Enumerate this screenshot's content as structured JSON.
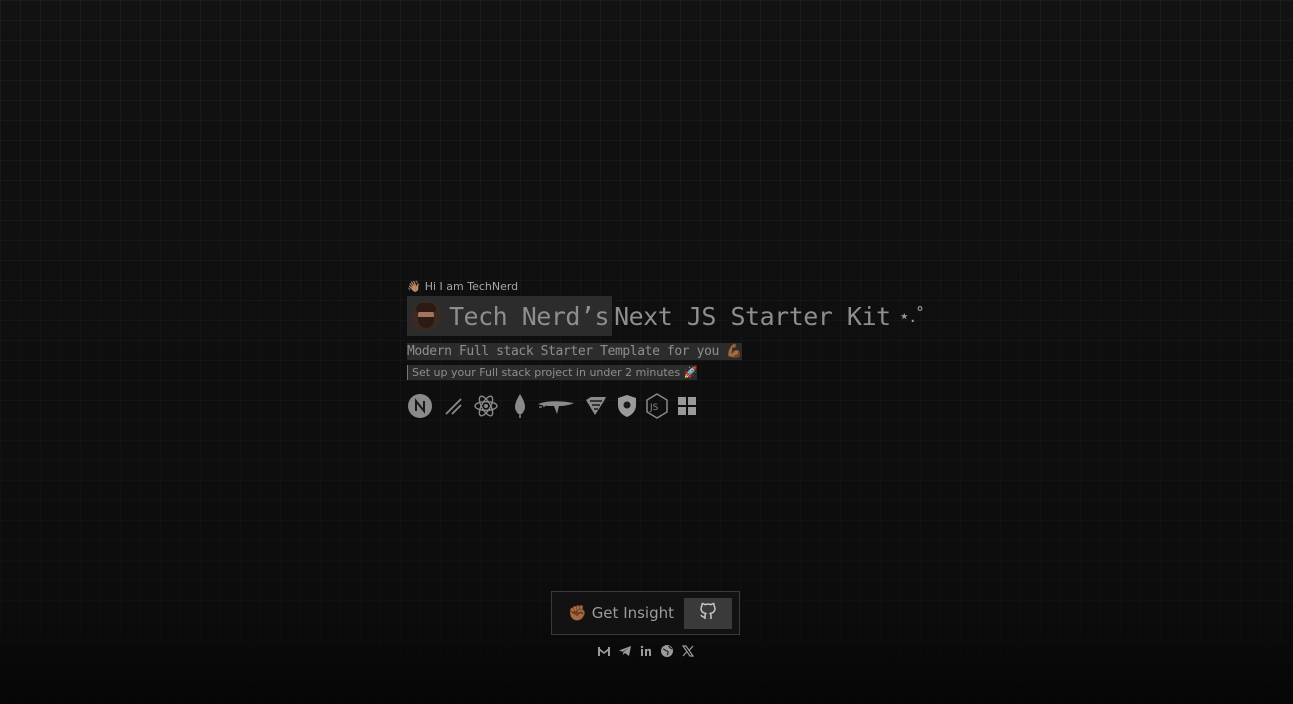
{
  "hero": {
    "greeting_emoji": "👋🏽",
    "greeting": "Hi I am TechNerd",
    "title_name": "Tech Nerd’s",
    "title_rest": "Next JS Starter Kit",
    "title_sparkle": "⋆.˚",
    "subtitle": "Modern Full stack Starter Template for you",
    "subtitle_emoji": "💪🏾",
    "tagline": "Set up your Full stack project in under 2 minutes",
    "tagline_emoji": "🚀"
  },
  "tech_stack": [
    "nextjs-icon",
    "shadcn-icon",
    "react-icon",
    "mongodb-icon",
    "prisma-icon",
    "zod-icon",
    "auth-shield-icon",
    "nodejs-icon",
    "grid-icon"
  ],
  "cta": {
    "insight_emoji": "✊🏾",
    "insight_label": "Get Insight",
    "github_icon": "github-icon"
  },
  "socials": [
    "gmail-icon",
    "telegram-icon",
    "linkedin-icon",
    "globe-icon",
    "x-icon"
  ],
  "colors": {
    "background": "#111111",
    "chip": "#2c2c2c",
    "text": "#8e8e8e",
    "button": "#3a3a3a"
  }
}
